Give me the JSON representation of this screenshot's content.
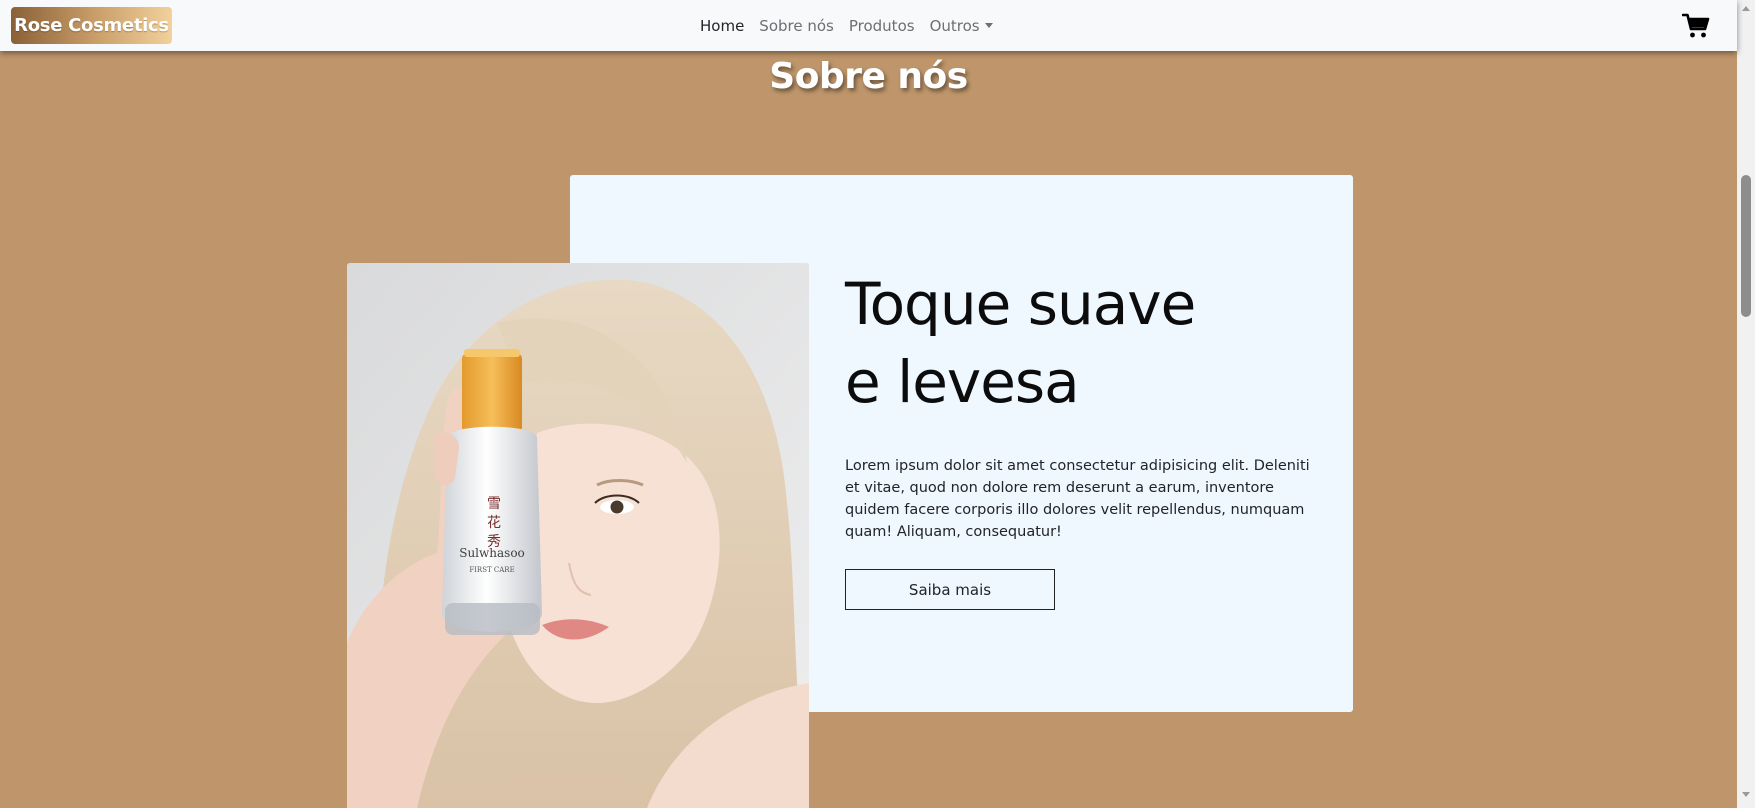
{
  "navbar": {
    "brand": "Rose Cosmetics",
    "links": [
      {
        "label": "Home",
        "active": true
      },
      {
        "label": "Sobre nós",
        "active": false
      },
      {
        "label": "Produtos",
        "active": false
      },
      {
        "label": "Outros",
        "active": false,
        "dropdown": true
      }
    ],
    "cart_icon": "shopping-cart-icon"
  },
  "section": {
    "title": "Sobre nós",
    "heading_line1": "Toque suave",
    "heading_line2": "e levesa",
    "text": "Lorem ipsum dolor sit amet consectetur adipisicing elit. Deleniti et vitae, quod non dolore rem deserunt a earum, inventore quidem facere corporis illo dolores velit repellendus, numquam quam! Aliquam, consequatur!",
    "button": "Saiba mais",
    "photo": {
      "product_brand": "Sulwhasoo",
      "product_line": "FIRST CARE"
    }
  },
  "colors": {
    "background": "#bf966b",
    "card": "#eff7ff",
    "navbar": "#f8f9fa",
    "brand_gradient_start": "#8a6038",
    "brand_gradient_end": "#f2d19c"
  }
}
